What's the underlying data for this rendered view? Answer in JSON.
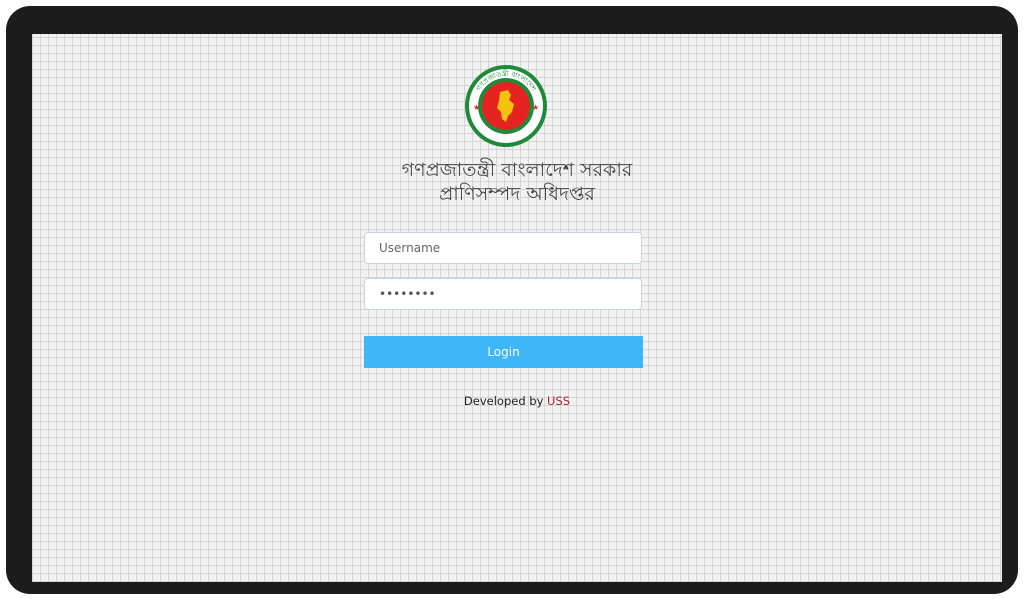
{
  "header": {
    "line1": "গণপ্রজাতন্ত্রী বাংলাদেশ সরকার",
    "line2": "প্রাণিসম্পদ অধিদপ্তর",
    "logo_icon": "government-seal-icon",
    "logo_ring_text": "গণপ্রজাতন্ত্রী বাংলাদেশ",
    "logo_bottom_text": "সরকার"
  },
  "form": {
    "username_placeholder": "Username",
    "username_value": "",
    "password_value": "••••••••",
    "login_label": "Login"
  },
  "footer": {
    "developed_by": "Developed by ",
    "developer": "USS"
  },
  "colors": {
    "accent": "#3fb6f5",
    "seal_green": "#1f8a3a",
    "seal_red": "#e52421",
    "link": "#b0232a"
  }
}
